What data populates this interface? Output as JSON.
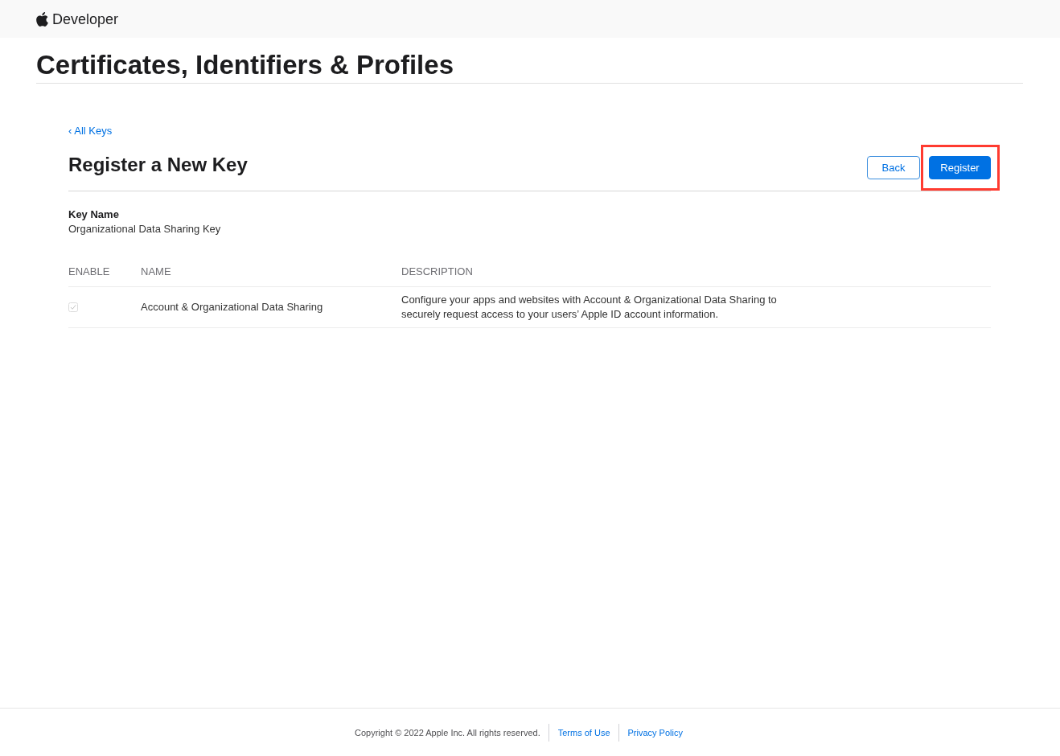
{
  "header": {
    "brand": "Developer"
  },
  "page_title": "Certificates, Identifiers & Profiles",
  "back_link": "‹ All Keys",
  "heading": "Register a New Key",
  "actions": [
    {
      "label": "Back",
      "kind": "secondary",
      "highlighted": false
    },
    {
      "label": "Register",
      "kind": "primary",
      "highlighted": true
    }
  ],
  "key_name": {
    "label": "Key Name",
    "value": "Organizational Data Sharing Key"
  },
  "table": {
    "columns": [
      "ENABLE",
      "NAME",
      "DESCRIPTION"
    ],
    "rows": [
      {
        "checked": true,
        "disabled": true,
        "name": "Account & Organizational Data Sharing",
        "description": "Configure your apps and websites with Account & Organizational Data Sharing to securely request access to your users’ Apple ID account information."
      }
    ]
  },
  "footer": {
    "copyright": "Copyright © 2022 Apple Inc. All rights reserved.",
    "links": [
      "Terms of Use",
      "Privacy Policy"
    ]
  }
}
